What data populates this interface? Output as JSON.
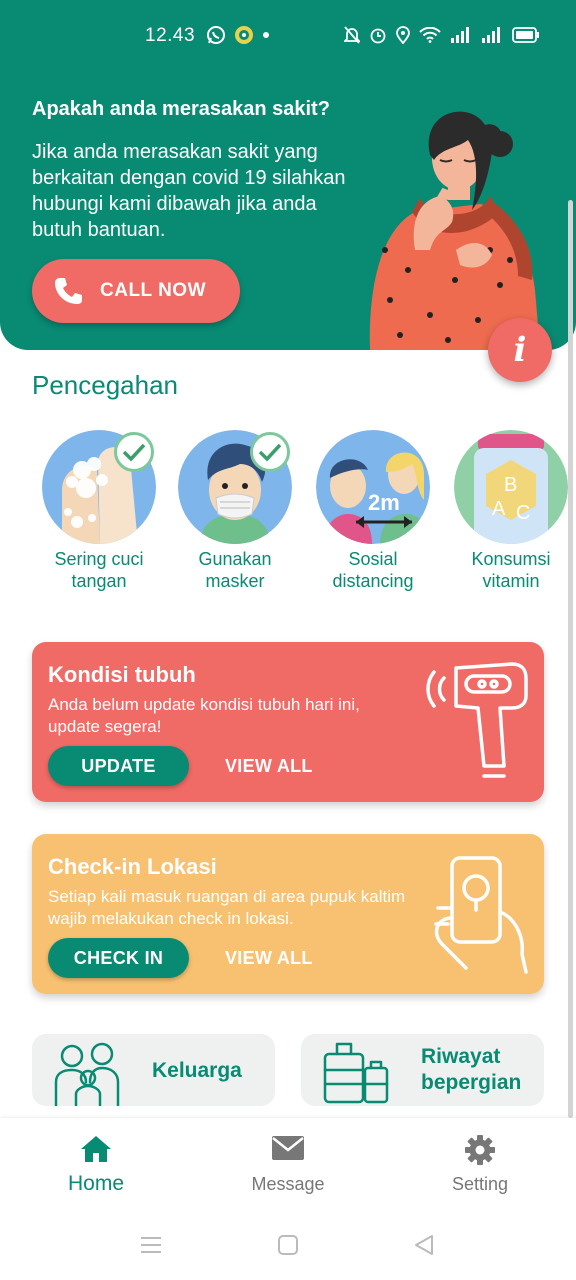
{
  "status_bar": {
    "time": "12.43",
    "left_icons": [
      "whatsapp-icon",
      "app-badge-icon",
      "dot-icon"
    ],
    "right_icons": [
      "mute-icon",
      "alarm-icon",
      "location-icon",
      "wifi-icon",
      "signal-icon",
      "signal-icon",
      "battery-icon"
    ]
  },
  "hero": {
    "title": "Apakah anda merasakan sakit?",
    "text": "Jika anda merasakan sakit yang berkaitan dengan covid 19 silahkan hubungi kami dibawah jika anda butuh bantuan.",
    "call_label": "CALL NOW",
    "info_label": "i"
  },
  "prevention": {
    "title": "Pencegahan",
    "items": [
      {
        "label": "Sering cuci tangan",
        "icon": "hand-wash-icon"
      },
      {
        "label": "Gunakan masker",
        "icon": "mask-icon"
      },
      {
        "label": "Sosial distancing",
        "icon": "distancing-icon",
        "distance": "2m"
      },
      {
        "label": "Konsumsi vitamin",
        "icon": "vitamin-icon",
        "letters": [
          "B",
          "A",
          "C"
        ]
      }
    ]
  },
  "cards": {
    "kondisi": {
      "title": "Kondisi tubuh",
      "text": "Anda belum update kondisi tubuh hari ini, update segera!",
      "primary": "UPDATE",
      "secondary": "VIEW ALL"
    },
    "checkin": {
      "title": "Check-in Lokasi",
      "text": "Setiap kali masuk ruangan di area pupuk kaltim wajib melakukan check in lokasi.",
      "primary": "CHECK IN",
      "secondary": "VIEW ALL"
    }
  },
  "tiles": {
    "keluarga": "Keluarga",
    "riwayat_line1": "Riwayat",
    "riwayat_line2": "bepergian"
  },
  "nav": {
    "home": "Home",
    "message": "Message",
    "setting": "Setting"
  },
  "colors": {
    "primary": "#098a73",
    "accent": "#f06a66",
    "warning": "#f7c171"
  }
}
